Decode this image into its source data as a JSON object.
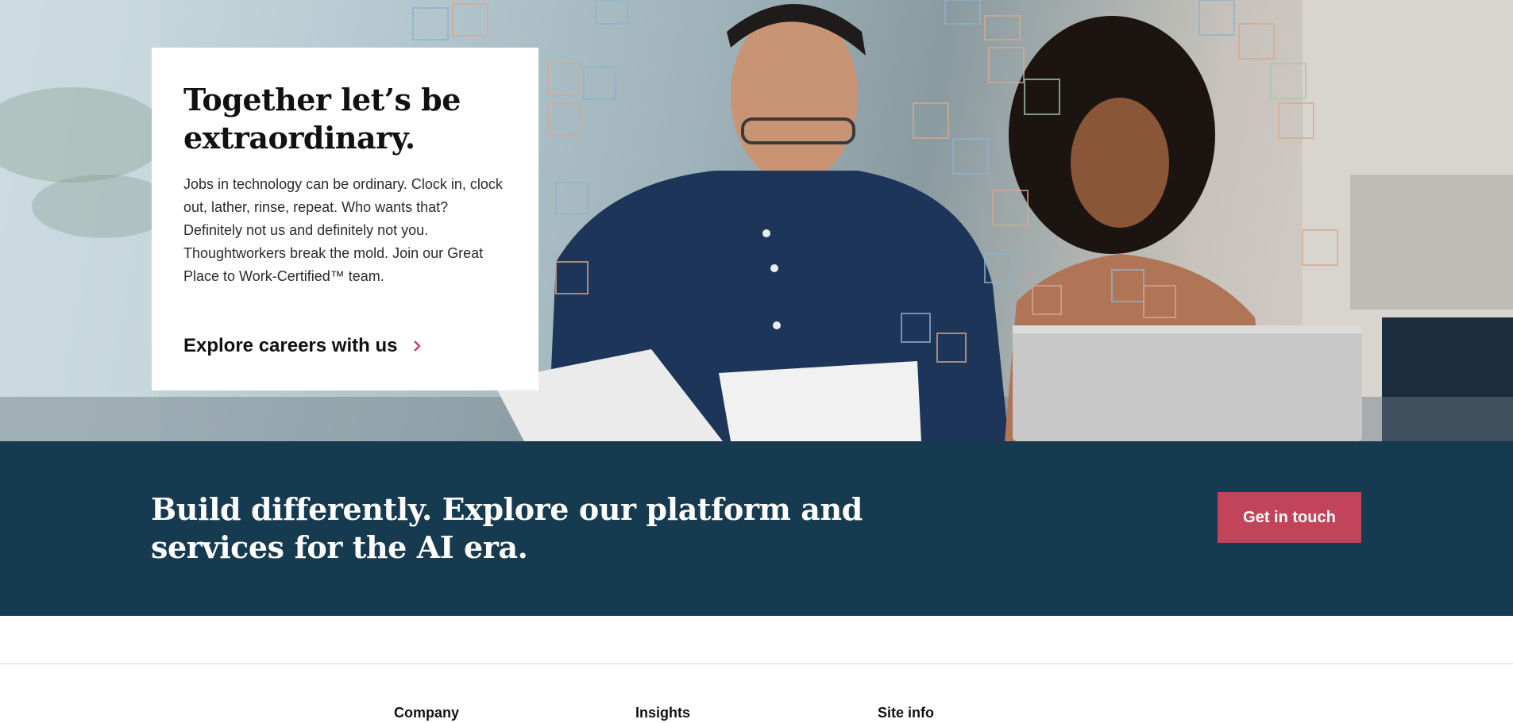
{
  "hero": {
    "title": "Together let’s be extraordinary.",
    "body": "Jobs in technology can be ordinary. Clock in, clock out, lather, rinse, repeat. Who wants that? Definitely not us and definitely not you. Thoughtworkers break the mold. Join our Great Place to Work-Certified™ team.",
    "link_label": "Explore careers with us",
    "link_icon": "chevron-right-icon",
    "accent_color": "#c2445b"
  },
  "cta": {
    "title": "Build differently. Explore our platform and services for the AI era.",
    "button_label": "Get in touch",
    "background_color": "#163a4f",
    "button_color": "#c2445b"
  },
  "footer": {
    "columns": [
      "Company",
      "Insights",
      "Site info"
    ]
  }
}
